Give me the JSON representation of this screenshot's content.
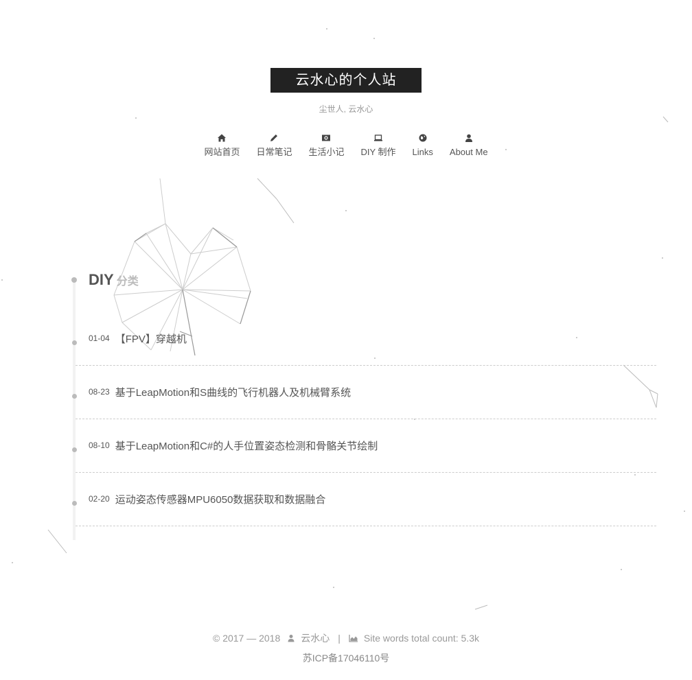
{
  "site": {
    "title": "云水心的个人站",
    "subtitle": "尘世人, 云水心"
  },
  "nav": {
    "items": [
      {
        "label": "网站首页",
        "icon": "home-icon"
      },
      {
        "label": "日常笔记",
        "icon": "pencil-icon"
      },
      {
        "label": "生活小记",
        "icon": "camera-icon"
      },
      {
        "label": "DIY 制作",
        "icon": "laptop-icon"
      },
      {
        "label": "Links",
        "icon": "globe-icon"
      },
      {
        "label": "About Me",
        "icon": "user-icon"
      }
    ]
  },
  "archive": {
    "title": "DIY",
    "title_suffix": "分类",
    "posts": [
      {
        "date": "01-04",
        "title": "【FPV】穿越机"
      },
      {
        "date": "08-23",
        "title": "基于LeapMotion和S曲线的飞行机器人及机械臂系统"
      },
      {
        "date": "08-10",
        "title": "基于LeapMotion和C#的人手位置姿态检测和骨骼关节绘制"
      },
      {
        "date": "02-20",
        "title": "运动姿态传感器MPU6050数据获取和数据融合"
      }
    ]
  },
  "footer": {
    "copyright": "© 2017 — 2018",
    "author": "云水心",
    "separator": "|",
    "wordcount": "Site words total count: 5.3k",
    "icp": "苏ICP备17046110号"
  },
  "colors": {
    "brand_bg": "#222222",
    "text": "#555555",
    "muted": "#999999"
  }
}
